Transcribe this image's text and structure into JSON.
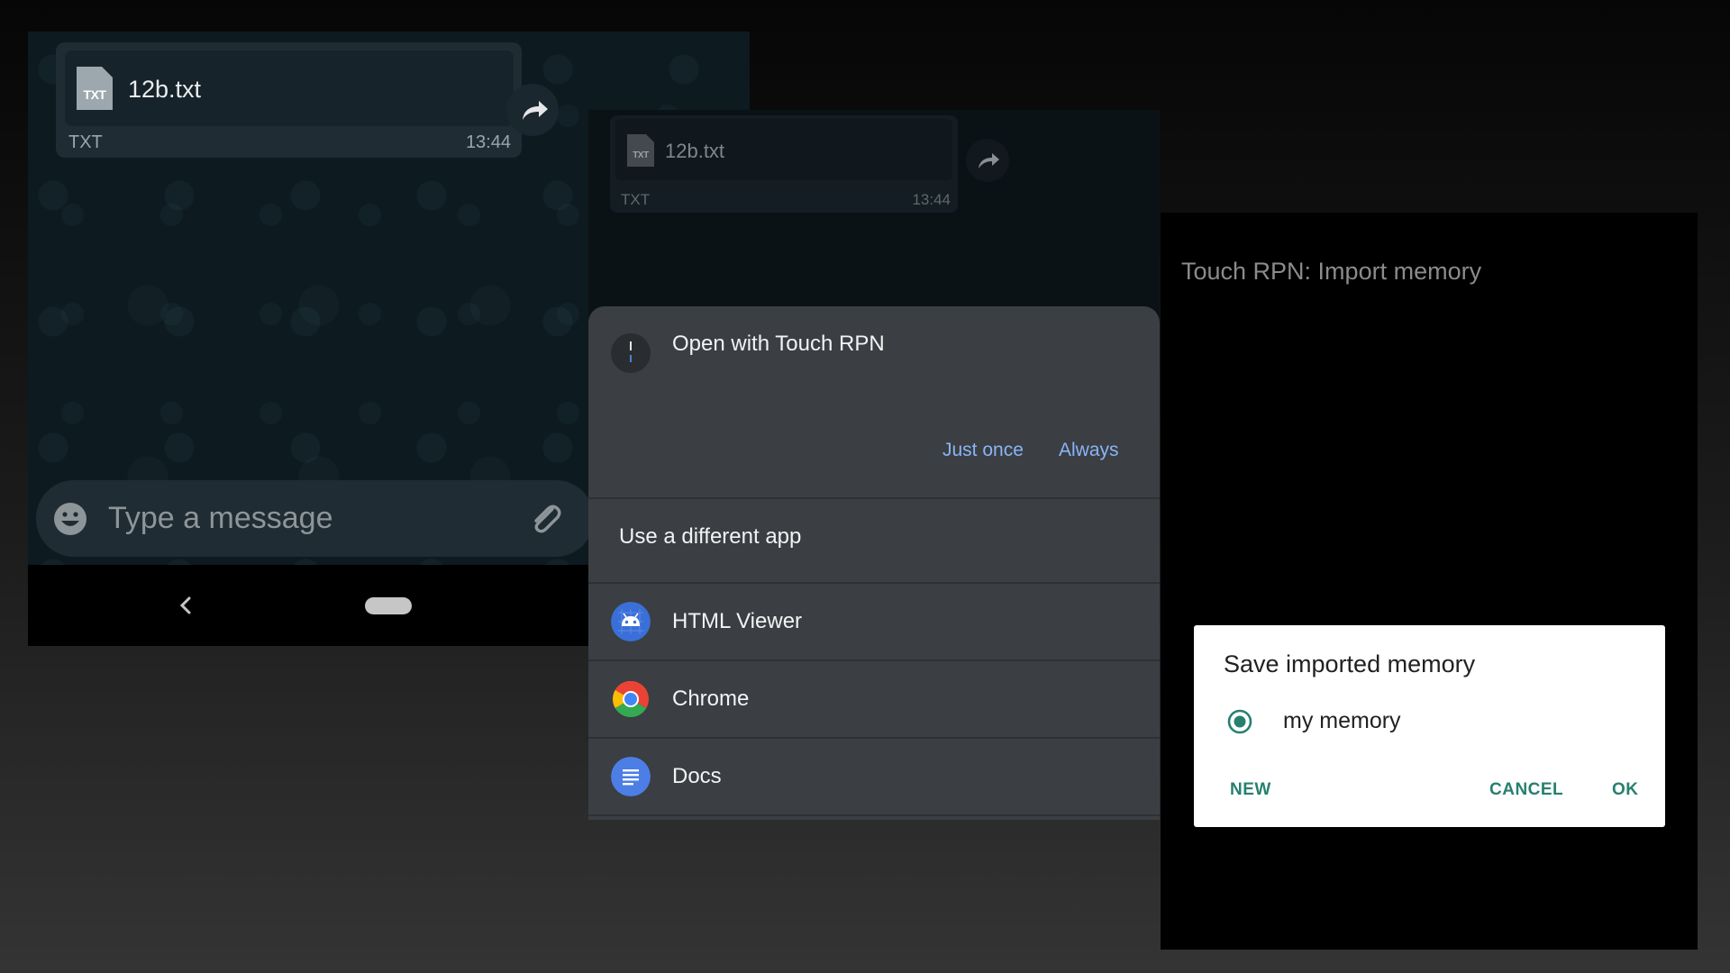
{
  "chat": {
    "file_badge": "TXT",
    "file_name": "12b.txt",
    "file_type": "TXT",
    "time": "13:44",
    "input_placeholder": "Type a message"
  },
  "open_with": {
    "dim_file_badge": "TXT",
    "dim_file_name": "12b.txt",
    "dim_file_type": "TXT",
    "dim_time": "13:44",
    "title": "Open with Touch RPN",
    "just_once": "Just once",
    "always": "Always",
    "different_app": "Use a different app",
    "apps": [
      {
        "name": "HTML Viewer",
        "icon": "android-icon"
      },
      {
        "name": "Chrome",
        "icon": "chrome-icon"
      },
      {
        "name": "Docs",
        "icon": "docs-icon"
      }
    ]
  },
  "rpn": {
    "title": "Touch RPN: Import memory",
    "dialog": {
      "title": "Save imported memory",
      "option": "my memory",
      "option_selected": true,
      "new": "NEW",
      "cancel": "CANCEL",
      "ok": "OK"
    }
  },
  "colors": {
    "accent_blue": "#8ab4f8",
    "dialog_teal": "#26806f",
    "chat_bubble": "#1f2c34"
  }
}
